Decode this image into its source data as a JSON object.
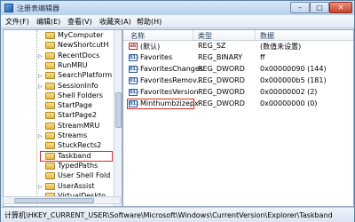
{
  "window": {
    "title": "注册表编辑器",
    "min_glyph": "–",
    "max_glyph": "□",
    "close_glyph": "✕"
  },
  "menu": [
    "文件(F)",
    "编辑(E)",
    "查看(V)",
    "收藏夹(A)",
    "帮助(H)"
  ],
  "tree": {
    "items": [
      {
        "label": "MyComputer",
        "expander": ""
      },
      {
        "label": "NewShortcutH",
        "expander": ""
      },
      {
        "label": "RecentDocs",
        "expander": "▷"
      },
      {
        "label": "RunMRU",
        "expander": ""
      },
      {
        "label": "SearchPlatform",
        "expander": "▷"
      },
      {
        "label": "SessionInfo",
        "expander": "▷"
      },
      {
        "label": "Shell Folders",
        "expander": ""
      },
      {
        "label": "StartPage",
        "expander": ""
      },
      {
        "label": "StartPage2",
        "expander": ""
      },
      {
        "label": "StreamMRU",
        "expander": ""
      },
      {
        "label": "Streams",
        "expander": "▷"
      },
      {
        "label": "StuckRects2",
        "expander": ""
      },
      {
        "label": "Taskband",
        "expander": ""
      },
      {
        "label": "TypedPaths",
        "expander": ""
      },
      {
        "label": "User Shell Fold",
        "expander": ""
      },
      {
        "label": "UserAssist",
        "expander": "▷"
      },
      {
        "label": "VirtualDeskto",
        "expander": ""
      }
    ],
    "highlighted": "Taskband"
  },
  "list": {
    "columns": [
      "名称",
      "类型",
      "数据"
    ],
    "rows": [
      {
        "icon": "string-value-icon",
        "glyph": "ab",
        "name": "(默认)",
        "type": "REG_SZ",
        "data": "(数值未设置)"
      },
      {
        "icon": "binary-value-icon",
        "glyph": "011",
        "name": "Favorites",
        "type": "REG_BINARY",
        "data": "ff"
      },
      {
        "icon": "binary-value-icon",
        "glyph": "011",
        "name": "FavoritesChanges",
        "type": "REG_DWORD",
        "data": "0x00000090 (144)"
      },
      {
        "icon": "binary-value-icon",
        "glyph": "011",
        "name": "FavoritesRemov...",
        "type": "REG_DWORD",
        "data": "0x000000b5 (181)"
      },
      {
        "icon": "binary-value-icon",
        "glyph": "011",
        "name": "FavoritesVersion",
        "type": "REG_DWORD",
        "data": "0x00000002 (2)"
      },
      {
        "icon": "binary-value-icon",
        "glyph": "011",
        "name": "Minthumbzizepx",
        "type": "REG_DWORD",
        "data": "0x00000000 (0)"
      }
    ],
    "highlighted": "Minthumbzizepx"
  },
  "status": {
    "path": "计算机\\HKEY_CURRENT_USER\\Software\\Microsoft\\Windows\\CurrentVersion\\Explorer\\Taskband"
  },
  "colors": {
    "highlight_border": "#d8281e",
    "titlebar": "#b9d1ec"
  }
}
